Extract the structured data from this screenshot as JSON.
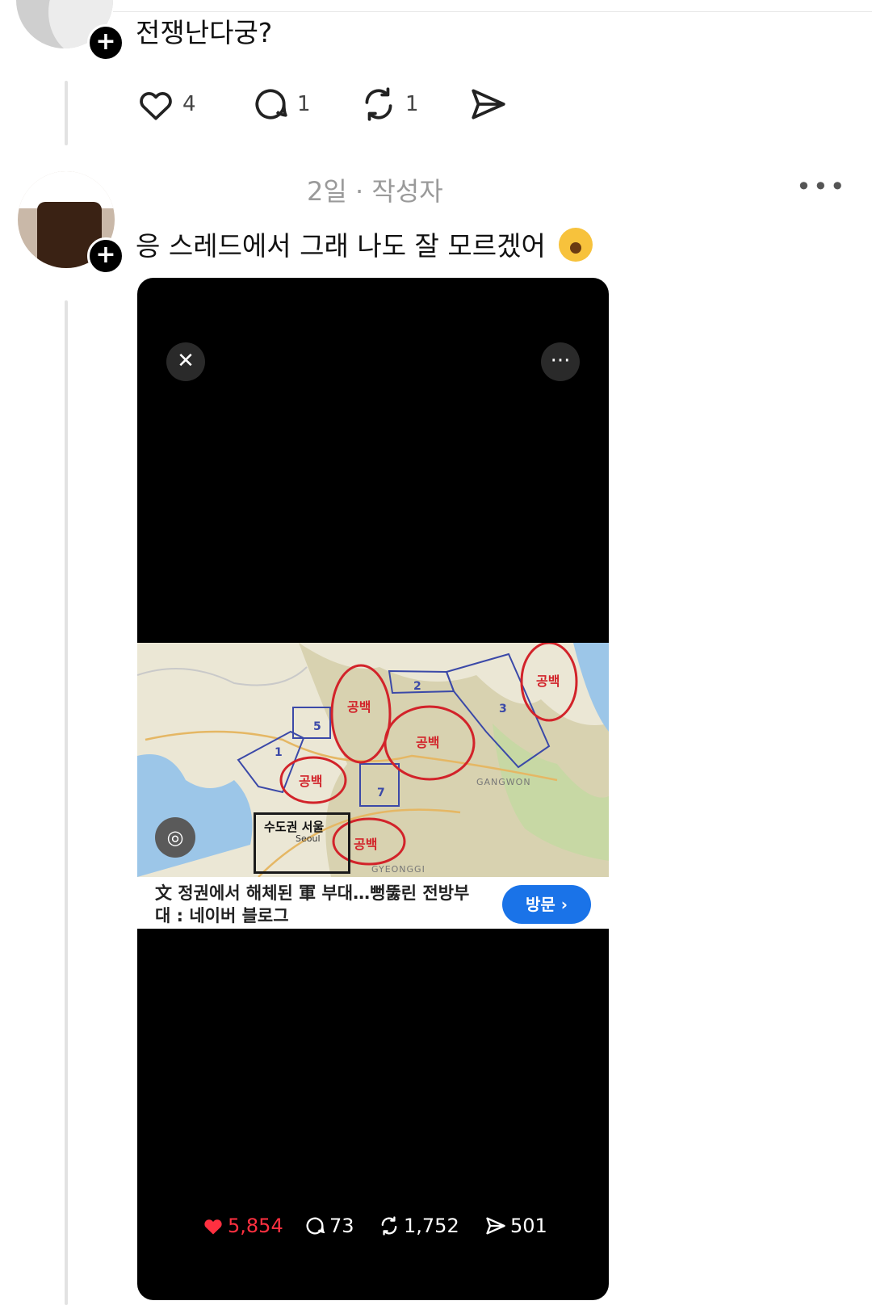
{
  "post1": {
    "text": "전쟁난다궁?",
    "actions": {
      "likes": "4",
      "replies": "1",
      "reposts": "1"
    }
  },
  "post2": {
    "meta": "2일 · 작성자",
    "more": "•••",
    "text": "응 스레드에서 그래 나도 잘 모르겠어",
    "emoji": "face-with-hand-over-mouth"
  },
  "media": {
    "close_icon": "✕",
    "more_icon": "···",
    "map_label_capital": "수도권 서울",
    "map_region_labels": [
      "공백",
      "공백",
      "공백",
      "공백",
      "공백",
      "1",
      "2",
      "3",
      "5",
      "7"
    ],
    "map_place_labels": [
      "GANGWON",
      "GYEONGGI",
      "Seoul"
    ],
    "caption": "文 정권에서 해체된 軍 부대…뻥뚫린 전방부대 : 네이버 블로그",
    "visit_button": "방문 ›",
    "stats": {
      "likes": "5,854",
      "replies": "73",
      "reposts": "1,752",
      "shares": "501"
    }
  },
  "colors": {
    "like_red": "#ff3040",
    "visit_blue": "#1a73e8",
    "map_circle_red": "#d2232a",
    "map_box_blue": "#3b49a8"
  }
}
